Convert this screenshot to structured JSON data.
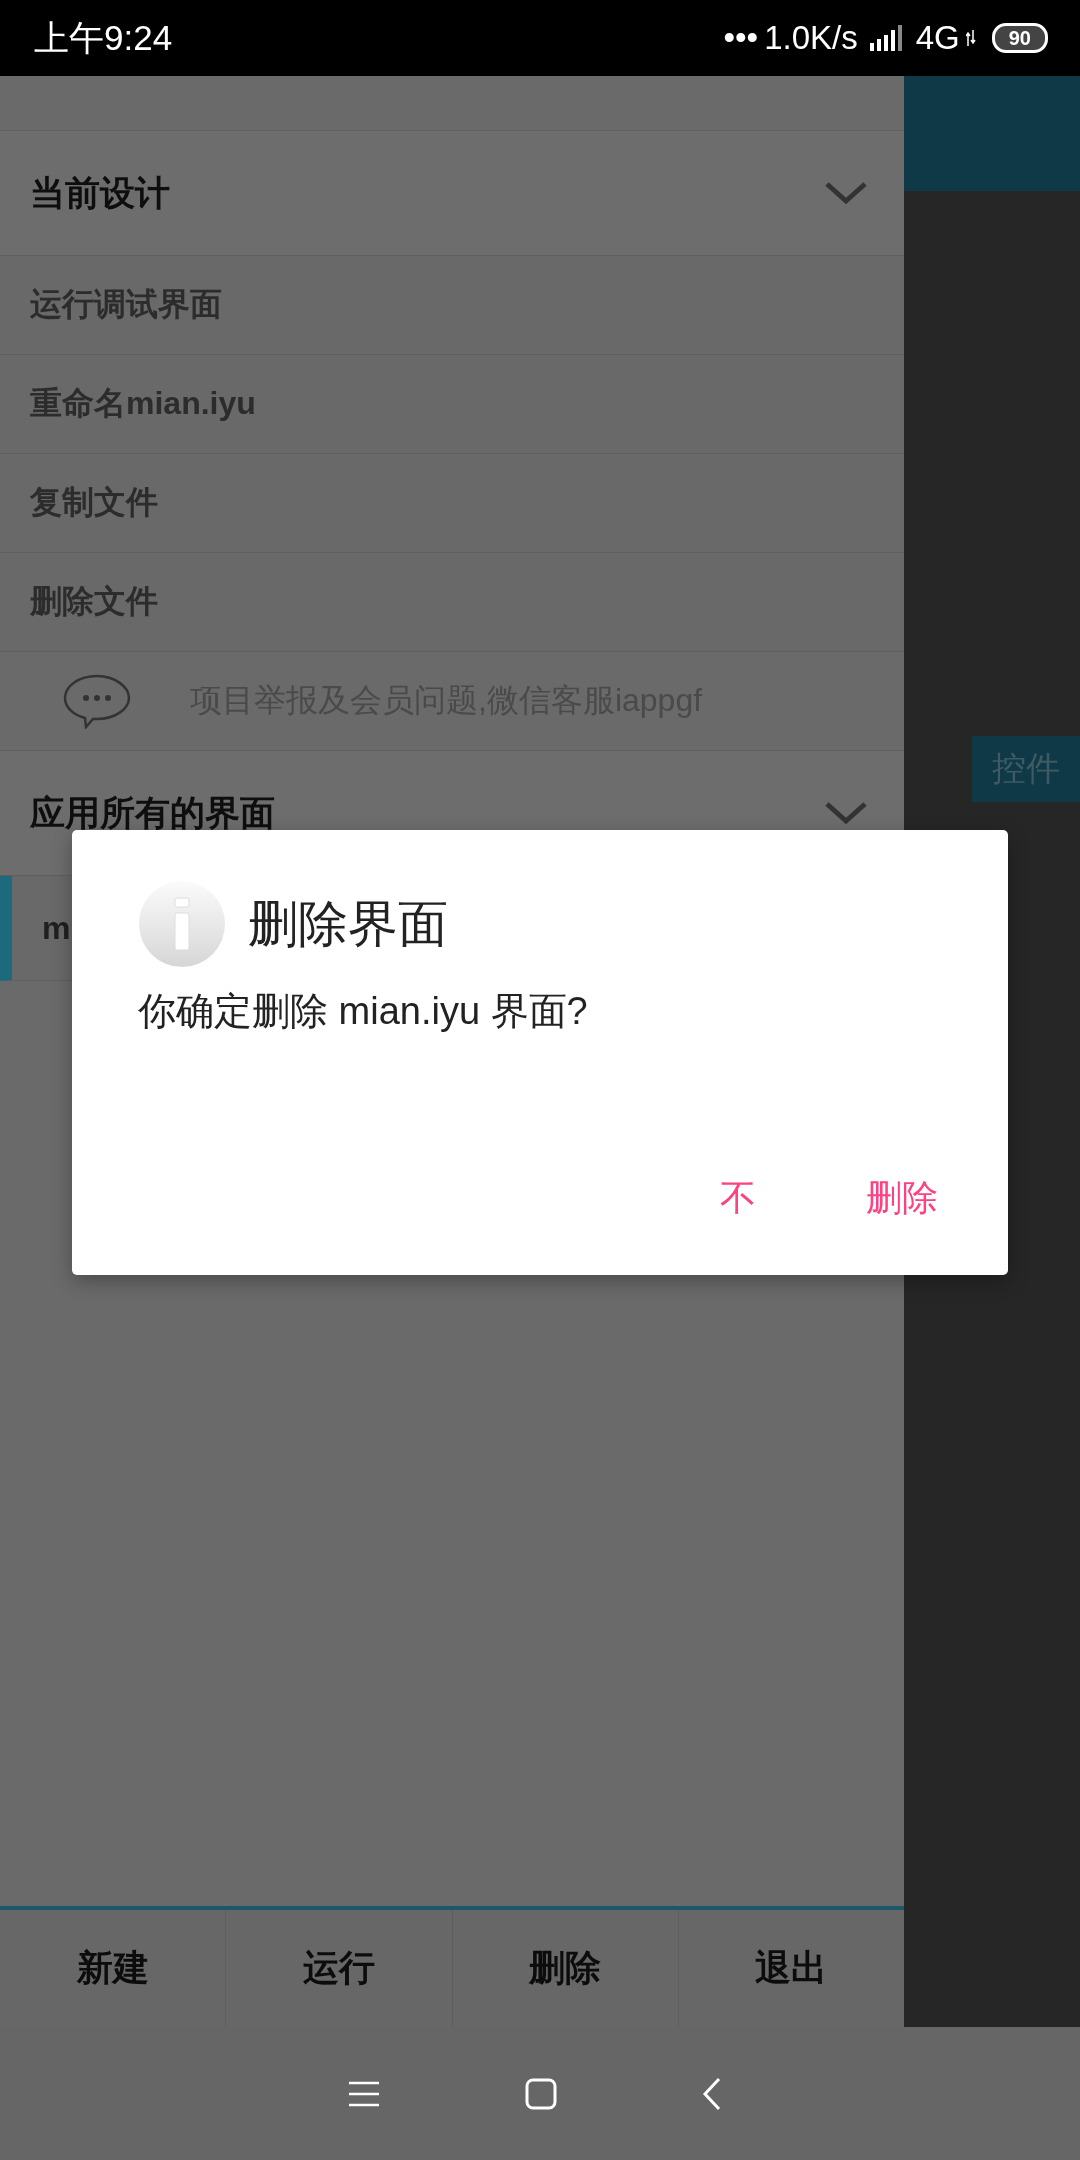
{
  "status_bar": {
    "time": "上午9:24",
    "dots": "•••",
    "network_speed": "1.0K/s",
    "network_type": "4G",
    "battery": "90"
  },
  "drawer": {
    "sections": [
      {
        "title": "当前设计",
        "items": [
          {
            "label": "运行调试界面"
          },
          {
            "label": "重命名mian.iyu"
          },
          {
            "label": "复制文件"
          },
          {
            "label": "删除文件"
          }
        ],
        "notice": "项目举报及会员问题,微信客服iappgf"
      },
      {
        "title": "应用所有的界面",
        "items": [
          {
            "label": "m",
            "selected": true
          }
        ]
      }
    ]
  },
  "side_button": "控件",
  "dialog": {
    "title": "删除界面",
    "message": "你确定删除 mian.iyu 界面?",
    "buttons": [
      "不",
      "删除"
    ]
  },
  "bottom_bar": [
    "新建",
    "运行",
    "删除",
    "退出"
  ]
}
